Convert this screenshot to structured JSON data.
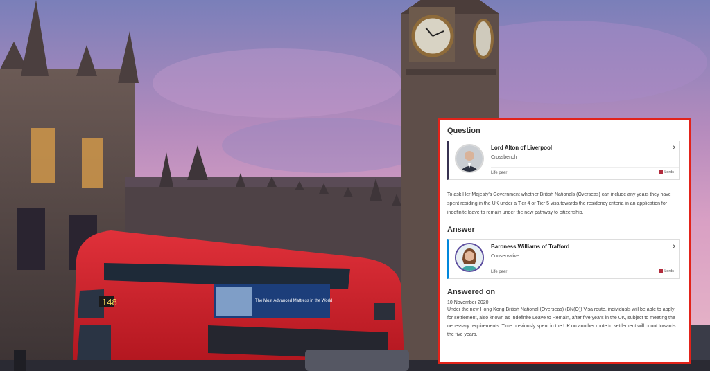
{
  "card": {
    "question_heading": "Question",
    "asker": {
      "name": "Lord Alton of Liverpool",
      "party": "Crossbench",
      "role": "Life peer",
      "house": "Lords"
    },
    "question_text": "To ask Her Majesty's Government whether British Nationals (Overseas) can include any years they have spent residing in the UK under a Tier 4 or Tier 5 visa towards the residency criteria in an application for indefinite leave to remain under the new pathway to citizenship.",
    "answer_heading": "Answer",
    "answerer": {
      "name": "Baroness Williams of Trafford",
      "party": "Conservative",
      "role": "Life peer",
      "house": "Lords"
    },
    "answered_on_heading": "Answered on",
    "answered_date": "10 November 2020",
    "answer_text": "Under the new Hong Kong British National (Overseas) (BN(O)) Visa route, individuals will be able to apply for settlement, also known as Indefinite Leave to Remain, after five years in the UK, subject to meeting the necessary requirements. Time previously spent in the UK on another route to settlement will count towards the five years."
  },
  "background": {
    "bus_route_number": "148",
    "bus_ad_text": "The Most Advanced Mattress in the World"
  },
  "colors": {
    "card_border": "#e2231a",
    "crossbench_bar": "#373151",
    "lords_badge": "#b22c3c"
  }
}
